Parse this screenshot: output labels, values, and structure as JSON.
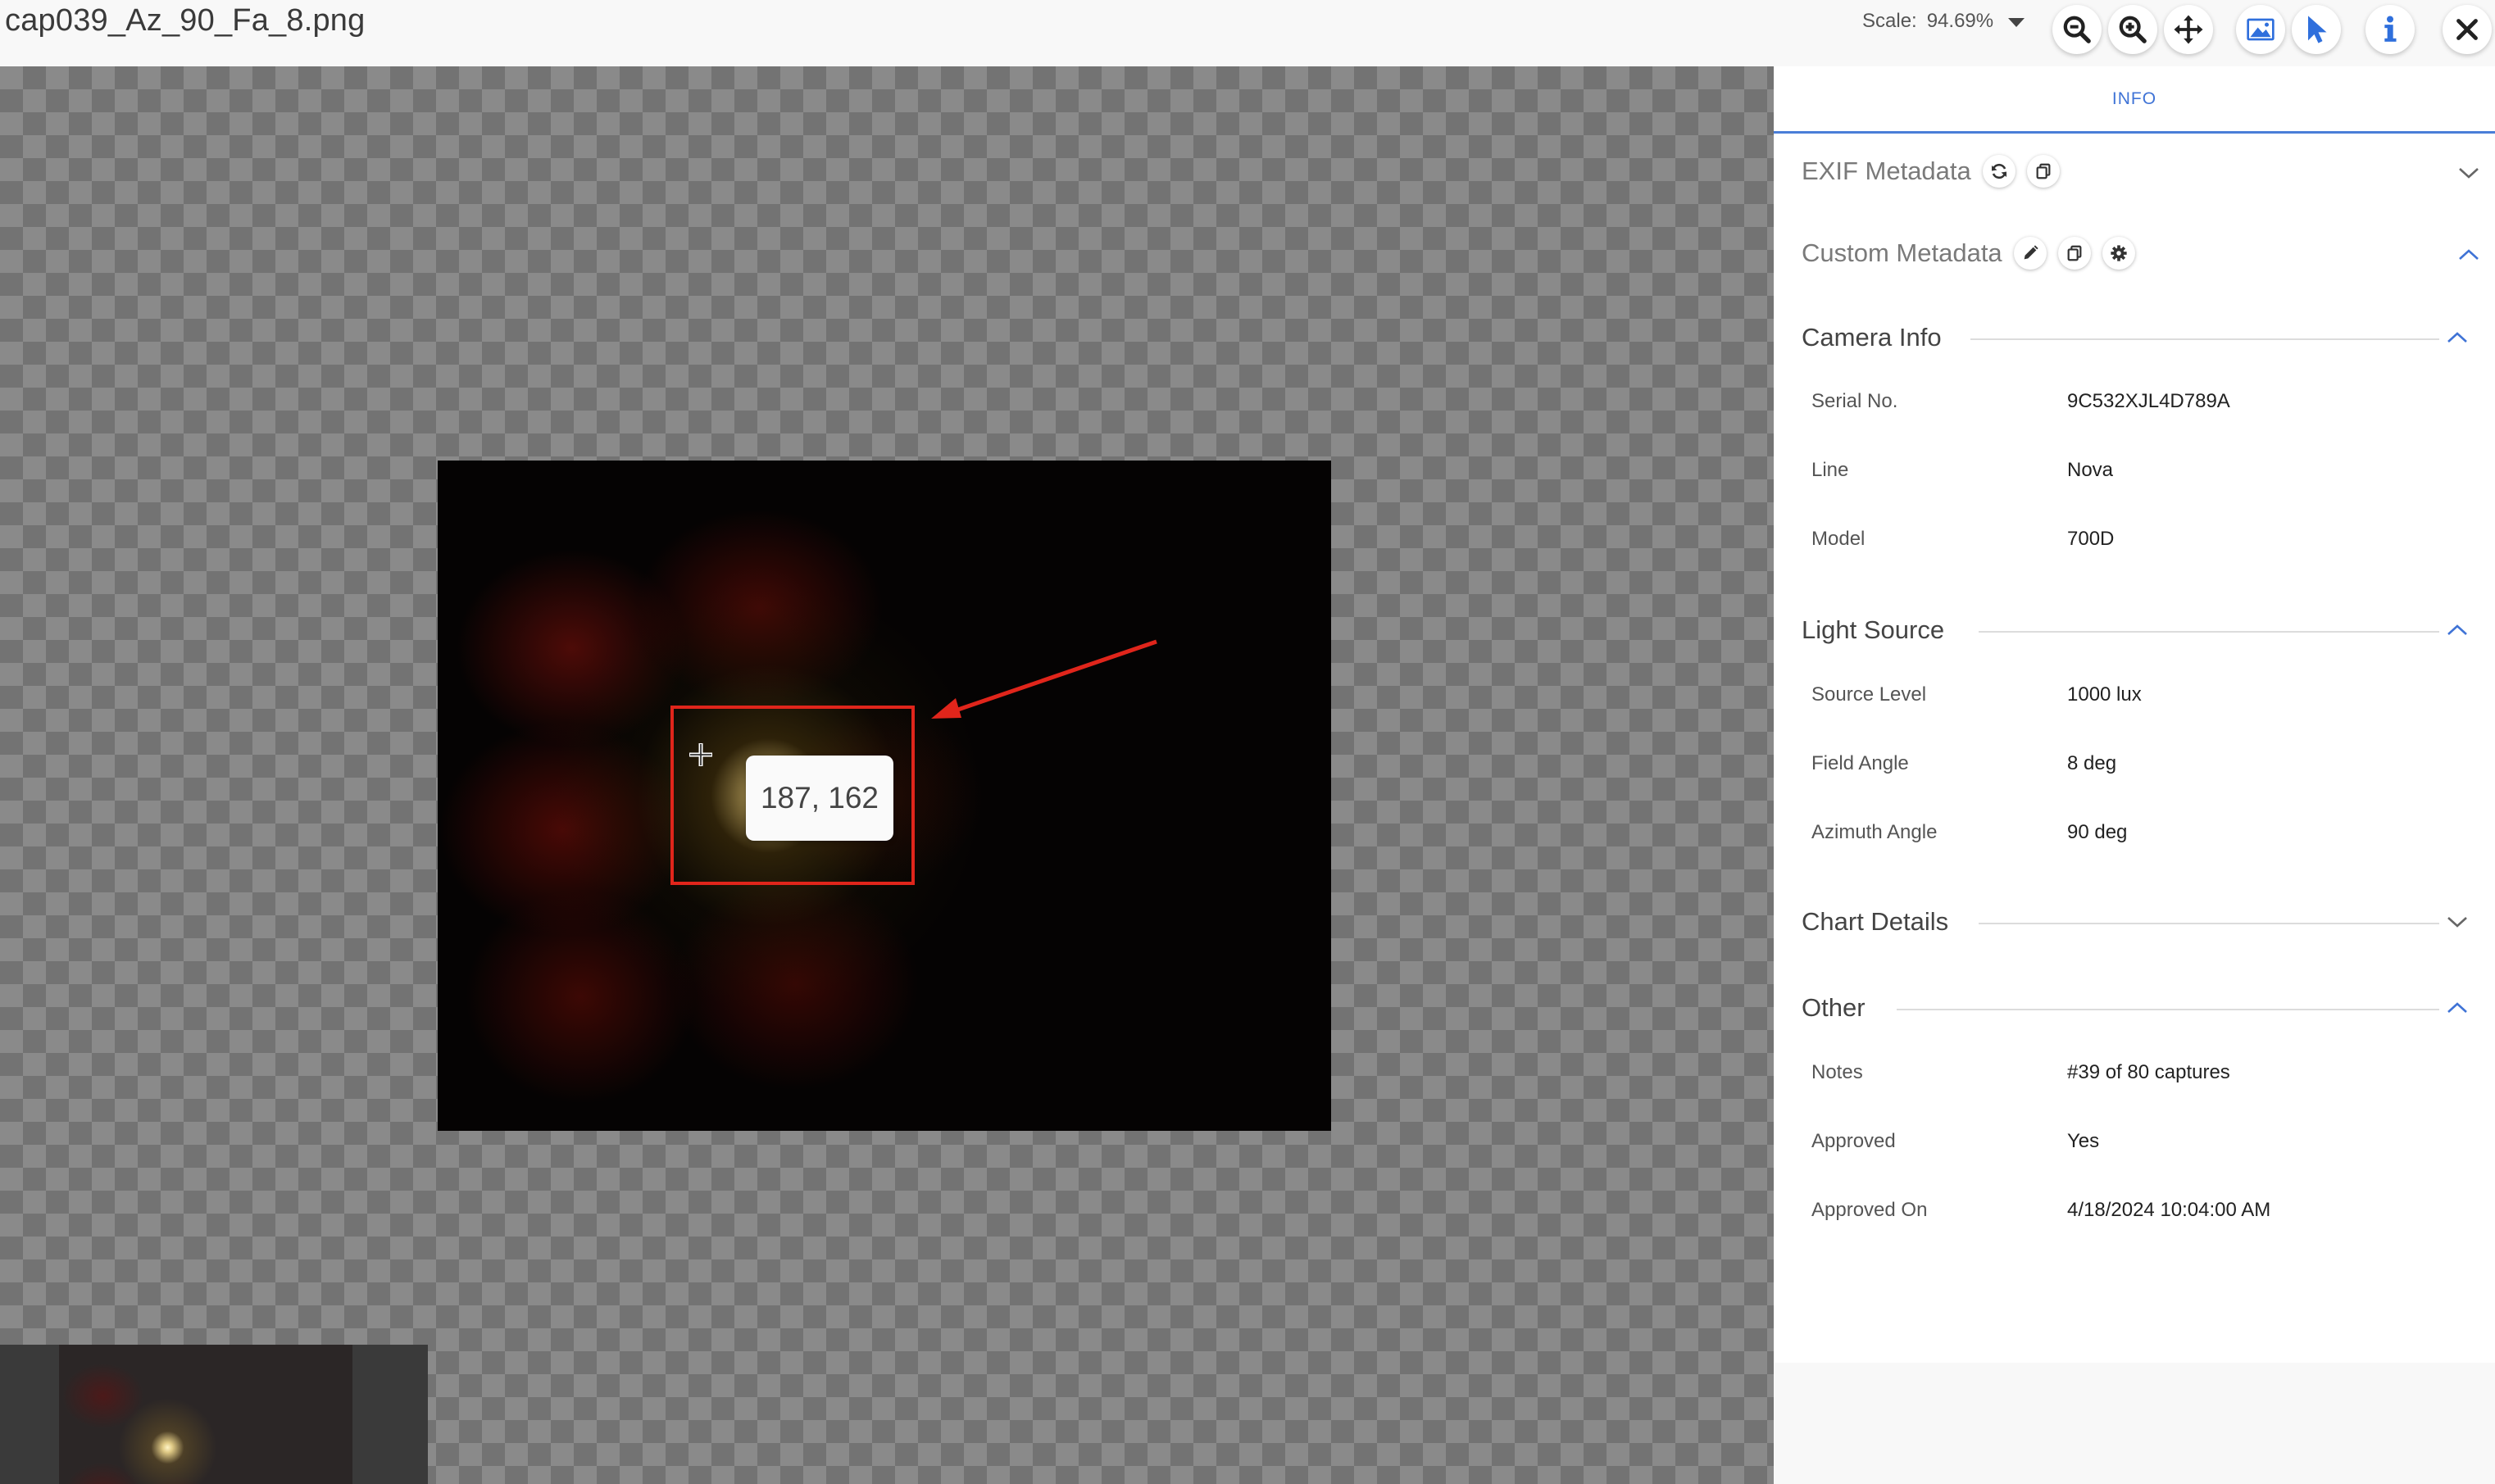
{
  "header": {
    "file_name": "cap039_Az_90_Fa_8.png",
    "scale_label": "Scale:",
    "scale_value": "94.69%"
  },
  "toolbar": {
    "icons": [
      "zoom-out-icon",
      "zoom-in-icon",
      "pan-icon",
      "image-icon",
      "pointer-icon",
      "info-icon",
      "close-icon"
    ]
  },
  "viewer": {
    "pixel_coordinate": "187, 162",
    "annotation_color": "#e0251b"
  },
  "panel": {
    "tab_label": "INFO",
    "accent": "#3f73d6",
    "exif_title": "EXIF Metadata",
    "custom_title": "Custom Metadata",
    "groups": [
      {
        "title": "Camera Info",
        "expanded": true,
        "rows": [
          {
            "label": "Serial No.",
            "value": "9C532XJL4D789A"
          },
          {
            "label": "Line",
            "value": "Nova"
          },
          {
            "label": "Model",
            "value": "700D"
          }
        ]
      },
      {
        "title": "Light Source",
        "expanded": true,
        "rows": [
          {
            "label": "Source Level",
            "value": "1000  lux"
          },
          {
            "label": "Field Angle",
            "value": "8  deg"
          },
          {
            "label": "Azimuth Angle",
            "value": "90  deg"
          }
        ]
      },
      {
        "title": "Chart Details",
        "expanded": false,
        "rows": []
      },
      {
        "title": "Other",
        "expanded": true,
        "rows": [
          {
            "label": "Notes",
            "value": "#39 of 80 captures"
          },
          {
            "label": "Approved",
            "value": "Yes"
          },
          {
            "label": "Approved On",
            "value": "4/18/2024 10:04:00 AM"
          }
        ]
      }
    ]
  }
}
